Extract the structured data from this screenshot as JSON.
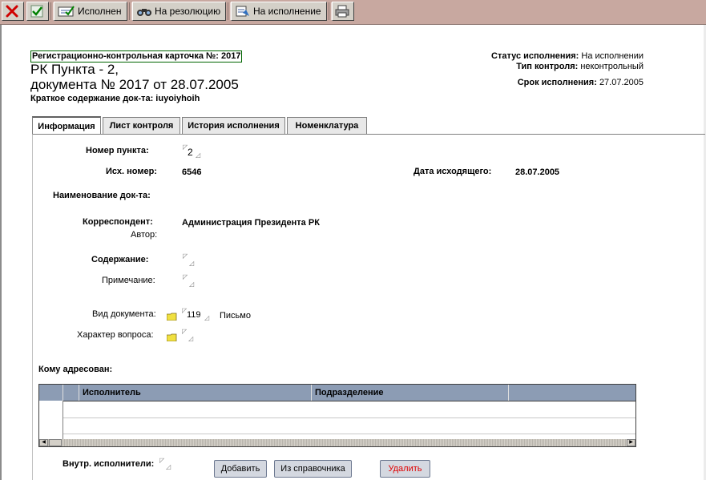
{
  "toolbar": {
    "ispolnen": "Исполнен",
    "na_rezolyuciyu": "На резолюцию",
    "na_ispolnenie": "На исполнение"
  },
  "header": {
    "reg_card": "Регистрационно-контрольная карточка №: 2017",
    "rk_point": "РК Пункта -  2,",
    "document": "документа №  2017 от 28.07.2005",
    "short_label": "Краткое содержание док-та:",
    "short_value": "iuyoiyhoih"
  },
  "status": {
    "status_label": "Статус исполнения:",
    "status_value": "На исполнении",
    "control_label": "Тип контроля:",
    "control_value": "неконтрольный",
    "due_label": "Срок исполнения:",
    "due_value": "27.07.2005"
  },
  "tabs": [
    "Информация",
    "Лист контроля",
    "История исполнения",
    "Номенклатура"
  ],
  "form": {
    "point_label": "Номер пункта:",
    "point_value": "2",
    "out_num_label": "Исх. номер:",
    "out_num_value": "6546",
    "out_date_label": "Дата исходящего:",
    "out_date_value": "28.07.2005",
    "doc_name_label": "Наименование док-та:",
    "correspondent_label": "Корреспондент:",
    "correspondent_value": "Администрация Президента РК",
    "author_label": "Автор:",
    "content_label": "Содержание:",
    "note_label": "Примечание:",
    "doc_type_label": "Вид документа:",
    "doc_type_code": "119",
    "doc_type_name": "Письмо",
    "question_label": "Характер вопроса:",
    "addressed_label": "Кому адресован:",
    "internal_label": "Внутр. исполнители:"
  },
  "grid": {
    "columns": [
      "Исполнитель",
      "Подразделение"
    ]
  },
  "buttons": {
    "add": "Добавить",
    "from_ref": "Из справочника",
    "delete": "Удалить"
  },
  "colors": {
    "toolbar_bg": "#c8a8a0",
    "grid_header": "#8c9cb4",
    "delete_text": "#e00000",
    "reg_border": "#006400"
  },
  "icons": [
    "close-icon",
    "check-icon",
    "executed-icon",
    "binoculars-icon",
    "send-icon",
    "printer-icon",
    "folder-icon"
  ]
}
